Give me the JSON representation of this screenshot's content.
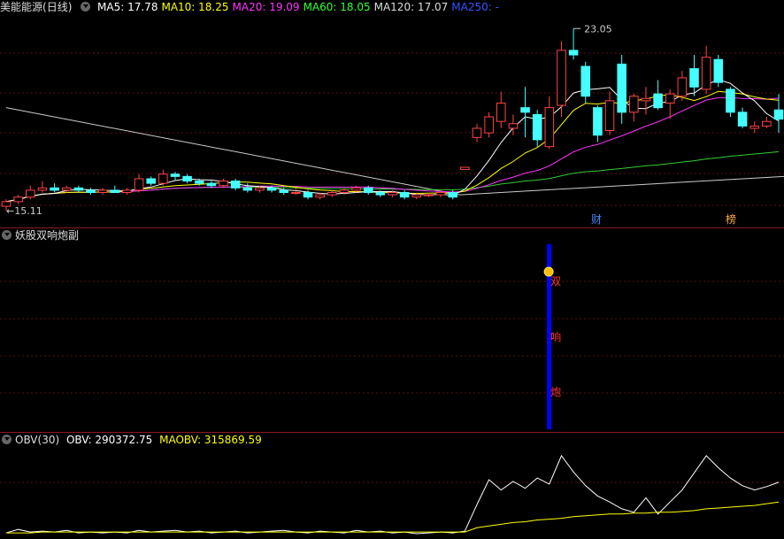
{
  "stock": {
    "name": "美能能源",
    "period": "(日线)"
  },
  "ma_legend": [
    {
      "label": "MA5: 17.78",
      "color": "#ffffff"
    },
    {
      "label": "MA10: 18.25",
      "color": "#ffff00"
    },
    {
      "label": "MA20: 19.09",
      "color": "#ff33ff"
    },
    {
      "label": "MA60: 18.05",
      "color": "#33ff33"
    },
    {
      "label": "MA120: 17.07",
      "color": "#dddddd"
    },
    {
      "label": "MA250: -",
      "color": "#3355ff"
    }
  ],
  "price_high_label": "23.05",
  "price_low_label": "15.11",
  "markers": [
    {
      "text": "财",
      "color": "#4488ff"
    },
    {
      "text": "榜",
      "color": "#ffaa33"
    }
  ],
  "indicator2": {
    "title": "妖股双响炮副",
    "signal_chars": [
      "双",
      "响",
      "炮"
    ]
  },
  "indicator3": {
    "title": "OBV(30)",
    "obv_label": "OBV: 290372.75",
    "maobv_label": "MAOBV: 315869.59"
  },
  "colors": {
    "up": "#ff4444",
    "down": "#44ffff",
    "signal": "#0000ff"
  },
  "chart_data": {
    "type": "candlestick",
    "candles": [
      [
        15.3,
        15.6,
        15.1,
        15.5
      ],
      [
        15.5,
        15.8,
        15.4,
        15.7
      ],
      [
        15.7,
        16.2,
        15.6,
        16.0
      ],
      [
        16.0,
        16.4,
        15.9,
        16.1
      ],
      [
        16.1,
        16.3,
        15.9,
        16.0
      ],
      [
        16.0,
        16.2,
        15.9,
        16.1
      ],
      [
        16.1,
        16.2,
        15.9,
        16.0
      ],
      [
        16.0,
        16.1,
        15.8,
        15.9
      ],
      [
        15.9,
        16.1,
        15.8,
        16.0
      ],
      [
        16.0,
        16.2,
        15.9,
        15.9
      ],
      [
        15.9,
        16.1,
        15.8,
        16.0
      ],
      [
        16.0,
        16.7,
        15.9,
        16.5
      ],
      [
        16.5,
        16.6,
        16.2,
        16.3
      ],
      [
        16.3,
        16.9,
        16.2,
        16.7
      ],
      [
        16.7,
        16.8,
        16.4,
        16.6
      ],
      [
        16.6,
        16.7,
        16.3,
        16.4
      ],
      [
        16.4,
        16.5,
        16.2,
        16.3
      ],
      [
        16.3,
        16.4,
        16.1,
        16.2
      ],
      [
        16.2,
        16.5,
        16.1,
        16.4
      ],
      [
        16.4,
        16.5,
        16.0,
        16.1
      ],
      [
        16.1,
        16.3,
        15.9,
        16.0
      ],
      [
        16.0,
        16.2,
        15.9,
        16.1
      ],
      [
        16.1,
        16.2,
        15.9,
        16.0
      ],
      [
        16.0,
        16.1,
        15.8,
        15.9
      ],
      [
        15.9,
        16.1,
        15.8,
        15.9
      ],
      [
        15.9,
        16.0,
        15.6,
        15.7
      ],
      [
        15.7,
        15.9,
        15.6,
        15.8
      ],
      [
        15.8,
        16.0,
        15.7,
        15.9
      ],
      [
        15.9,
        16.1,
        15.8,
        16.0
      ],
      [
        16.0,
        16.2,
        15.9,
        16.1
      ],
      [
        16.1,
        16.2,
        15.8,
        15.9
      ],
      [
        15.9,
        16.0,
        15.7,
        15.8
      ],
      [
        15.8,
        16.0,
        15.7,
        15.9
      ],
      [
        15.9,
        16.0,
        15.6,
        15.7
      ],
      [
        15.7,
        15.9,
        15.6,
        15.8
      ],
      [
        15.8,
        15.9,
        15.7,
        15.8
      ],
      [
        15.8,
        16.0,
        15.7,
        15.9
      ],
      [
        15.9,
        16.0,
        15.6,
        15.7
      ],
      [
        16.9,
        17.0,
        16.9,
        17.0
      ],
      [
        18.3,
        18.9,
        18.1,
        18.7
      ],
      [
        18.5,
        19.4,
        18.3,
        19.2
      ],
      [
        19.0,
        20.3,
        18.7,
        19.8
      ],
      [
        18.7,
        19.3,
        18.4,
        18.9
      ],
      [
        19.6,
        20.5,
        18.3,
        19.4
      ],
      [
        19.3,
        19.5,
        17.9,
        18.2
      ],
      [
        17.9,
        20.1,
        17.8,
        19.6
      ],
      [
        19.7,
        22.5,
        19.2,
        22.1
      ],
      [
        22.1,
        23.05,
        21.7,
        21.9
      ],
      [
        21.4,
        21.6,
        19.8,
        20.1
      ],
      [
        19.6,
        19.7,
        18.1,
        18.4
      ],
      [
        18.6,
        20.3,
        18.4,
        19.9
      ],
      [
        21.5,
        21.9,
        18.9,
        19.4
      ],
      [
        19.4,
        20.2,
        19.0,
        20.1
      ],
      [
        19.9,
        20.5,
        19.3,
        20.0
      ],
      [
        20.2,
        20.8,
        19.5,
        19.6
      ],
      [
        19.8,
        20.4,
        19.1,
        20.2
      ],
      [
        20.1,
        21.2,
        19.9,
        20.9
      ],
      [
        21.3,
        21.9,
        20.1,
        20.5
      ],
      [
        20.4,
        22.3,
        20.2,
        21.8
      ],
      [
        21.7,
        21.9,
        20.5,
        20.7
      ],
      [
        20.4,
        20.5,
        19.2,
        19.4
      ],
      [
        19.4,
        19.6,
        18.7,
        18.8
      ],
      [
        18.7,
        19.0,
        18.5,
        18.8
      ],
      [
        18.8,
        19.2,
        18.7,
        19.0
      ],
      [
        19.5,
        20.2,
        18.5,
        19.1
      ]
    ],
    "obv": [
      2,
      6,
      3,
      4,
      3,
      5,
      2,
      3,
      2,
      3,
      2,
      5,
      3,
      4,
      5,
      3,
      4,
      2,
      3,
      4,
      2,
      3,
      4,
      5,
      3,
      2,
      4,
      3,
      2,
      5,
      3,
      4,
      2,
      3,
      1,
      2,
      3,
      2,
      4,
      35,
      64,
      52,
      62,
      54,
      66,
      59,
      92,
      73,
      57,
      45,
      38,
      30,
      26,
      43,
      24,
      38,
      52,
      72,
      92,
      78,
      66,
      57,
      52,
      56,
      61
    ],
    "maobv": [
      2,
      2,
      2,
      3,
      3,
      3,
      3,
      3,
      3,
      3,
      3,
      3,
      3,
      3,
      3,
      3,
      3,
      3,
      3,
      3,
      3,
      3,
      3,
      3,
      3,
      3,
      3,
      3,
      3,
      3,
      3,
      3,
      3,
      3,
      3,
      3,
      3,
      3,
      3,
      8,
      10,
      12,
      14,
      15,
      17,
      18,
      19,
      21,
      22,
      23,
      24,
      24,
      25,
      25,
      26,
      26,
      27,
      28,
      30,
      31,
      32,
      33,
      34,
      36,
      38
    ],
    "price_range": [
      14.8,
      23.6
    ],
    "signal_index": 47
  }
}
